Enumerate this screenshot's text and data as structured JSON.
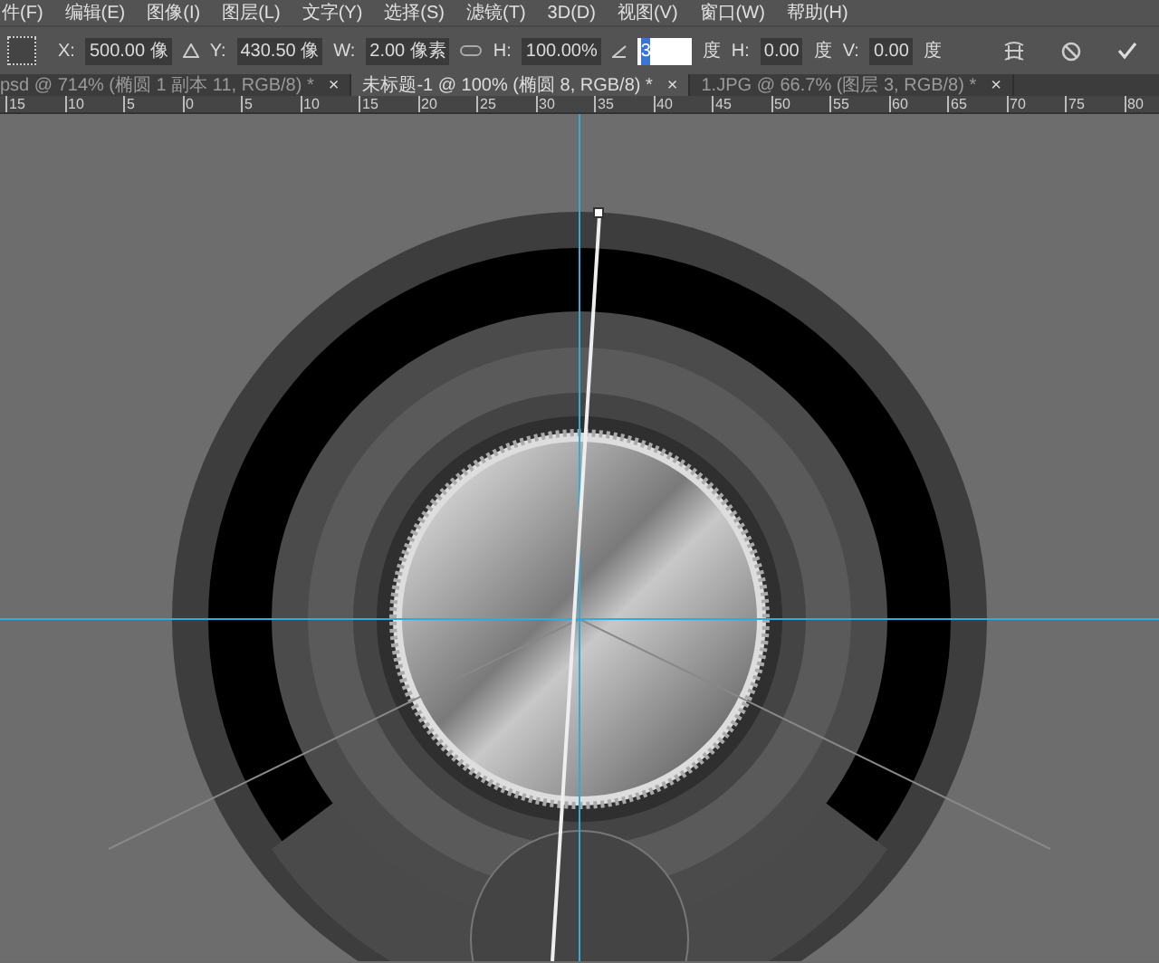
{
  "menu": [
    "件(F)",
    "编辑(E)",
    "图像(I)",
    "图层(L)",
    "文字(Y)",
    "选择(S)",
    "滤镜(T)",
    "3D(D)",
    "视图(V)",
    "窗口(W)",
    "帮助(H)"
  ],
  "options": [
    {
      "kind": "field",
      "label": "X:",
      "value": "500.00 像"
    },
    {
      "kind": "icon"
    },
    {
      "kind": "field",
      "label": "Y:",
      "value": "430.50 像"
    },
    {
      "kind": "field",
      "label": "W:",
      "value": "2.00 像素"
    },
    {
      "kind": "link"
    },
    {
      "kind": "field",
      "label": "H:",
      "value": "100.00%"
    },
    {
      "kind": "angle",
      "value": "3",
      "unit": "度"
    },
    {
      "kind": "field",
      "label": "H:",
      "value": "0.00",
      "unit": "度"
    },
    {
      "kind": "field",
      "label": "V:",
      "value": "0.00",
      "unit": "度"
    }
  ],
  "tabs": [
    {
      "label": "psd @ 714% (椭圆 1 副本 11, RGB/8) *",
      "close": "×",
      "selected": false
    },
    {
      "label": "未标题-1 @ 100% (椭圆 8, RGB/8) *",
      "close": "×",
      "selected": true
    },
    {
      "label": "1.JPG @ 66.7% (图层 3, RGB/8) *",
      "close": "×",
      "selected": false
    }
  ],
  "ruler": [
    "15",
    "10",
    "5",
    "0",
    "5",
    "10",
    "15",
    "20",
    "25",
    "30",
    "35",
    "40",
    "45",
    "50",
    "55",
    "60",
    "65",
    "70",
    "75",
    "80"
  ]
}
